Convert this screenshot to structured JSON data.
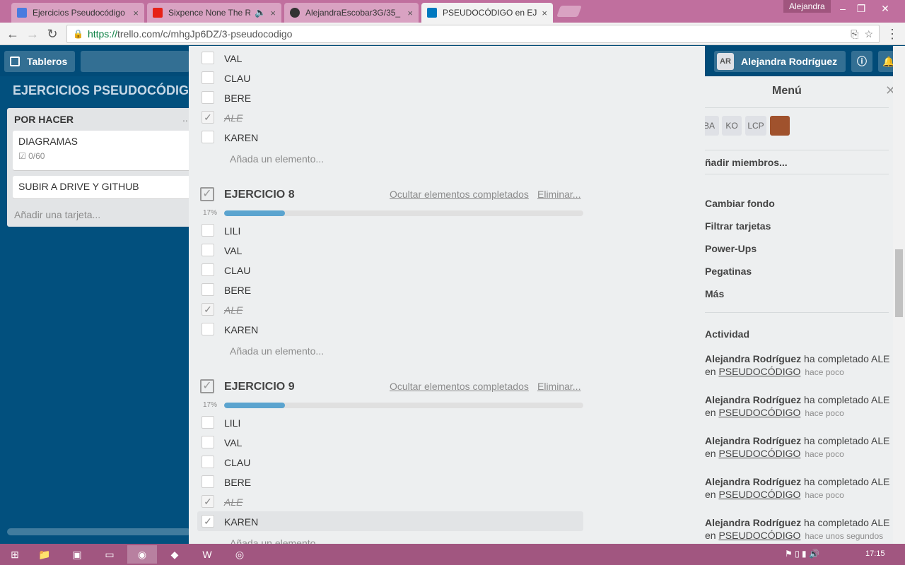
{
  "browser": {
    "tabs": [
      {
        "title": "Ejercicios Pseudocódigo",
        "icon": "docs-icon",
        "color": "#4a7bdf"
      },
      {
        "title": "Sixpence None The Ri",
        "icon": "youtube-icon",
        "color": "#e62117"
      },
      {
        "title": "AlejandraEscobar3G/35_",
        "icon": "github-icon",
        "color": "#333333"
      },
      {
        "title": "PSEUDOCÓDIGO en EJER",
        "icon": "trello-icon",
        "color": "#0079bf"
      }
    ],
    "user": "Alejandra",
    "url_scheme": "https://",
    "url_rest": "trello.com/c/mhgJp6DZ/3-pseudocodigo"
  },
  "header": {
    "boards_label": "Tableros",
    "user_initials": "AR",
    "user_name": "Alejandra Rodríguez"
  },
  "board": {
    "title": "EJERCICIOS PSEUDOCÓDIGO",
    "list": {
      "name": "POR HACER",
      "menu": "...",
      "cards": [
        {
          "title": "DIAGRAMAS",
          "badge": "0/60"
        },
        {
          "title": "SUBIR A DRIVE Y GITHUB"
        }
      ],
      "add_card": "Añadir una tarjeta..."
    }
  },
  "modal": {
    "top_items": [
      {
        "label": "VAL",
        "done": false
      },
      {
        "label": "CLAU",
        "done": false
      },
      {
        "label": "BERE",
        "done": false
      },
      {
        "label": "ALE",
        "done": true
      },
      {
        "label": "KAREN",
        "done": false
      }
    ],
    "add_item": "Añada un elemento...",
    "hide_completed": "Ocultar elementos completados",
    "delete": "Eliminar...",
    "checklists": [
      {
        "title": "EJERCICIO 8",
        "percent_label": "17%",
        "progress": 0.17,
        "items": [
          {
            "label": "LILI",
            "done": false
          },
          {
            "label": "VAL",
            "done": false
          },
          {
            "label": "CLAU",
            "done": false
          },
          {
            "label": "BERE",
            "done": false
          },
          {
            "label": "ALE",
            "done": true
          },
          {
            "label": "KAREN",
            "done": false
          }
        ]
      },
      {
        "title": "EJERCICIO 9",
        "percent_label": "17%",
        "progress": 0.17,
        "items": [
          {
            "label": "LILI",
            "done": false
          },
          {
            "label": "VAL",
            "done": false
          },
          {
            "label": "CLAU",
            "done": false
          },
          {
            "label": "BERE",
            "done": false
          },
          {
            "label": "ALE",
            "done": true
          },
          {
            "label": "KAREN",
            "done": false
          }
        ]
      }
    ],
    "partial_add": "Añada un elemento..."
  },
  "menu": {
    "title": "Menú",
    "members": [
      "BA",
      "KO",
      "LCP"
    ],
    "add_members": "ñadir miembros...",
    "items": [
      "Cambiar fondo",
      "Filtrar tarjetas",
      "Power-Ups",
      "Pegatinas",
      "Más"
    ],
    "activity_title": "Actividad",
    "activity": [
      {
        "user": "Alejandra Rodríguez",
        "action": "ha completado ALE",
        "prep": "en",
        "card": "PSEUDOCÓDIGO",
        "when": "hace poco"
      },
      {
        "user": "Alejandra Rodríguez",
        "action": "ha completado ALE",
        "prep": "en",
        "card": "PSEUDOCÓDIGO",
        "when": "hace poco"
      },
      {
        "user": "Alejandra Rodríguez",
        "action": "ha completado ALE",
        "prep": "en",
        "card": "PSEUDOCÓDIGO",
        "when": "hace poco"
      },
      {
        "user": "Alejandra Rodríguez",
        "action": "ha completado ALE",
        "prep": "en",
        "card": "PSEUDOCÓDIGO",
        "when": "hace poco"
      },
      {
        "user": "Alejandra Rodríguez",
        "action": "ha completado ALE",
        "prep": "en",
        "card": "PSEUDOCÓDIGO",
        "when": "hace unos segundos"
      }
    ]
  },
  "taskbar": {
    "time": "17:15"
  }
}
